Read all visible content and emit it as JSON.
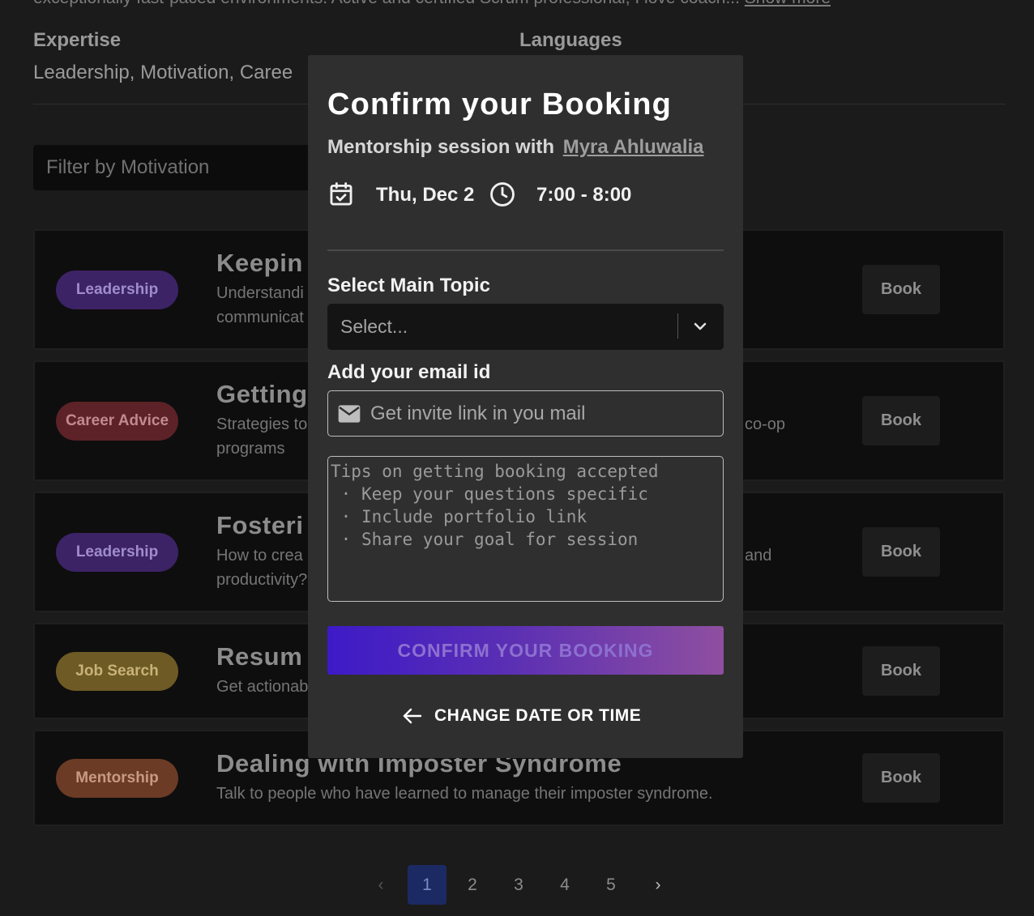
{
  "background": {
    "intro_text": "exceptionally fast-paced environments. Active and certified Scrum professional, I love coach...",
    "show_more": "Show more",
    "expertise_label": "Expertise",
    "expertise_value": "Leadership, Motivation, Caree",
    "languages_label": "Languages",
    "filter_placeholder": "Filter by Motivation",
    "sessions": [
      {
        "tag": "Leadership",
        "tag_color": "#3c2366",
        "tag_text_color": "#a08ccc",
        "title": "Keepin",
        "desc_left": "Understandi",
        "desc_left2": "communicat",
        "desc_right": "",
        "book": "Book"
      },
      {
        "tag": "Career Advice",
        "tag_color": "#5c2227",
        "tag_text_color": "#c08a8e",
        "title": "Getting",
        "desc_left": "Strategies to",
        "desc_left2": "programs",
        "desc_right": "co-op",
        "book": "Book"
      },
      {
        "tag": "Leadership",
        "tag_color": "#3c2366",
        "tag_text_color": "#a08ccc",
        "title": "Fosteri",
        "desc_left": "How to crea",
        "desc_left2": "productivity?",
        "desc_right": "and",
        "book": "Book"
      },
      {
        "tag": "Job Search",
        "tag_color": "#6e5a24",
        "tag_text_color": "#c8b27a",
        "title": "Resum",
        "desc_left": "Get actionab",
        "desc_left2": "",
        "desc_right": "",
        "book": "Book"
      },
      {
        "tag": "Mentorship",
        "tag_color": "#6b3b25",
        "tag_text_color": "#c79a84",
        "title": "Dealing with Imposter Syndrome",
        "desc_left": "Talk to people who have learned to manage their imposter syndrome.",
        "desc_left2": "",
        "desc_right": "",
        "book": "Book"
      }
    ],
    "pagination": {
      "prev": "‹",
      "next": "›",
      "pages": [
        "1",
        "2",
        "3",
        "4",
        "5"
      ],
      "current": "1"
    }
  },
  "modal": {
    "title": "Confirm your Booking",
    "subtitle_prefix": "Mentorship session with",
    "mentor_name": "Myra Ahluwalia",
    "date": "Thu, Dec 2",
    "time": "7:00 - 8:00",
    "topic_label": "Select Main Topic",
    "topic_placeholder": "Select...",
    "email_label": "Add your email id",
    "email_placeholder": "Get invite link in you mail",
    "notes_placeholder": "Tips on getting booking accepted\n · Keep your questions specific\n · Include portfolio link\n · Share your goal for session",
    "confirm_button": "CONFIRM YOUR BOOKING",
    "change_button": "CHANGE DATE OR TIME"
  },
  "icons": {
    "calendar": "calendar-check-icon",
    "clock": "clock-icon",
    "chevron": "chevron-down-icon",
    "mail": "mail-icon",
    "back": "arrow-left-icon"
  },
  "colors": {
    "accent_gradient_start": "#3d1ac7",
    "accent_gradient_end": "#8f4fa0",
    "pager_active": "#1c2a63"
  }
}
